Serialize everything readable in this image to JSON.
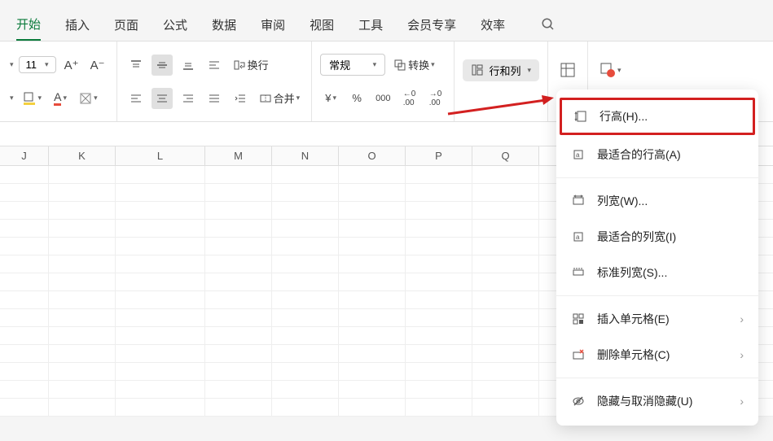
{
  "tabs": {
    "items": [
      "开始",
      "插入",
      "页面",
      "公式",
      "数据",
      "审阅",
      "视图",
      "工具",
      "会员专享",
      "效率"
    ],
    "active": 0
  },
  "ribbon": {
    "font_size": "11",
    "wrap_label": "换行",
    "merge_label": "合并",
    "format_selected": "常规",
    "convert_label": "转换",
    "rows_cols_label": "行和列"
  },
  "columns": [
    "J",
    "K",
    "L",
    "M",
    "N",
    "O",
    "P",
    "Q"
  ],
  "menu": {
    "row_height": "行高(H)...",
    "best_row_height": "最适合的行高(A)",
    "col_width": "列宽(W)...",
    "best_col_width": "最适合的列宽(I)",
    "std_col_width": "标准列宽(S)...",
    "insert_cells": "插入单元格(E)",
    "delete_cells": "删除单元格(C)",
    "hide_unhide": "隐藏与取消隐藏(U)"
  }
}
